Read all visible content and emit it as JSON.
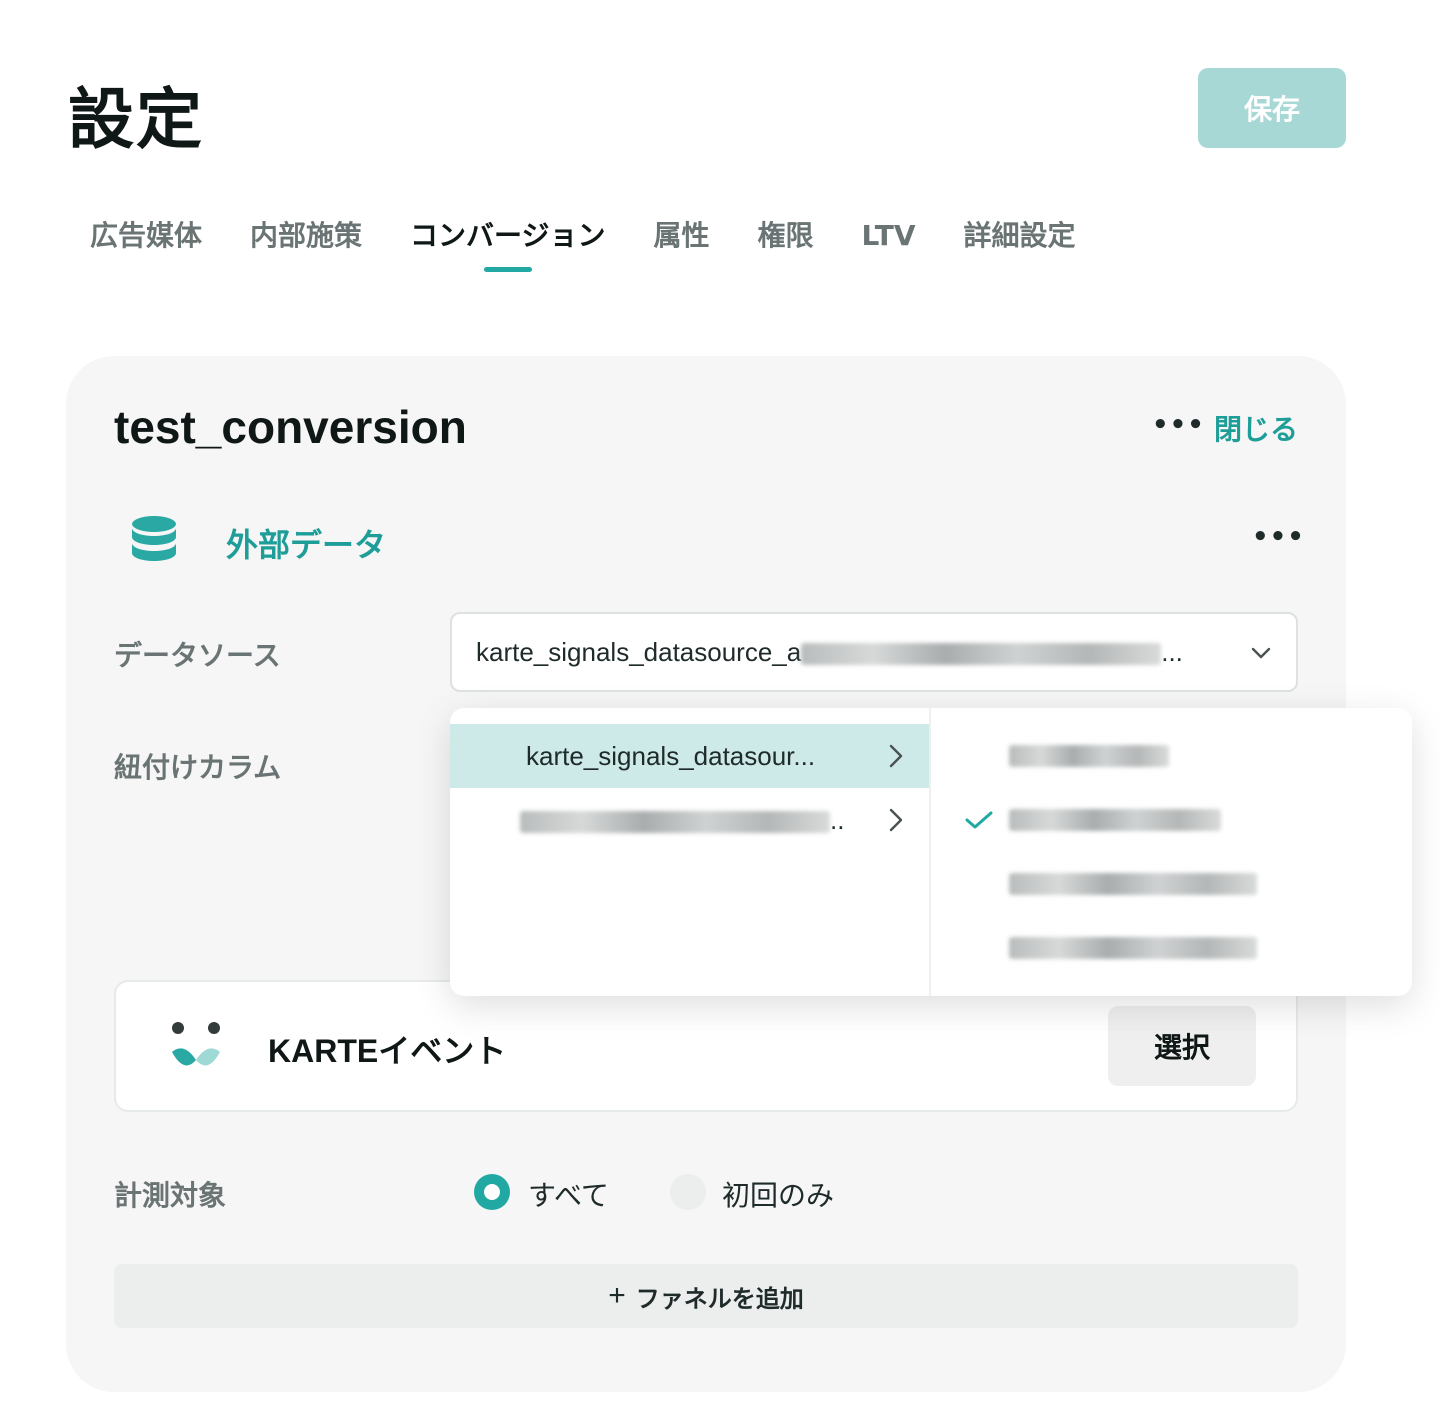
{
  "page": {
    "title": "設定",
    "save_label": "保存"
  },
  "tabs": [
    {
      "label": "広告媒体",
      "active": false
    },
    {
      "label": "内部施策",
      "active": false
    },
    {
      "label": "コンバージョン",
      "active": true
    },
    {
      "label": "属性",
      "active": false
    },
    {
      "label": "権限",
      "active": false
    },
    {
      "label": "LTV",
      "active": false
    },
    {
      "label": "詳細設定",
      "active": false
    }
  ],
  "card": {
    "title": "test_conversion",
    "close_label": "閉じる",
    "more_icon": "more-horizontal-icon",
    "section": {
      "title": "外部データ",
      "icon": "database-icon"
    },
    "datasource": {
      "label": "データソース",
      "value_prefix": "karte_signals_datasource_a",
      "ellipsis": "..."
    },
    "link_column": {
      "label": "紐付けカラム"
    },
    "karte_event": {
      "label": "KARTEイベント",
      "button_label": "選択",
      "icon": "karte-logo-icon"
    },
    "measurement": {
      "label": "計測対象",
      "options": [
        {
          "label": "すべて",
          "selected": true
        },
        {
          "label": "初回のみ",
          "selected": false
        }
      ]
    },
    "add_funnel_label": "ファネルを追加"
  },
  "dropdown": {
    "left_items": [
      {
        "label": "karte_signals_datasour...",
        "highlighted": true
      },
      {
        "label": "..",
        "highlighted": false
      }
    ],
    "right_items": [
      {
        "checked": false
      },
      {
        "checked": true
      },
      {
        "checked": false
      },
      {
        "checked": false
      }
    ]
  },
  "colors": {
    "accent": "#21a8a3",
    "accent_text": "#1f9e99",
    "save_disabled": "#a8d8d6",
    "highlight": "#cde9e8"
  }
}
